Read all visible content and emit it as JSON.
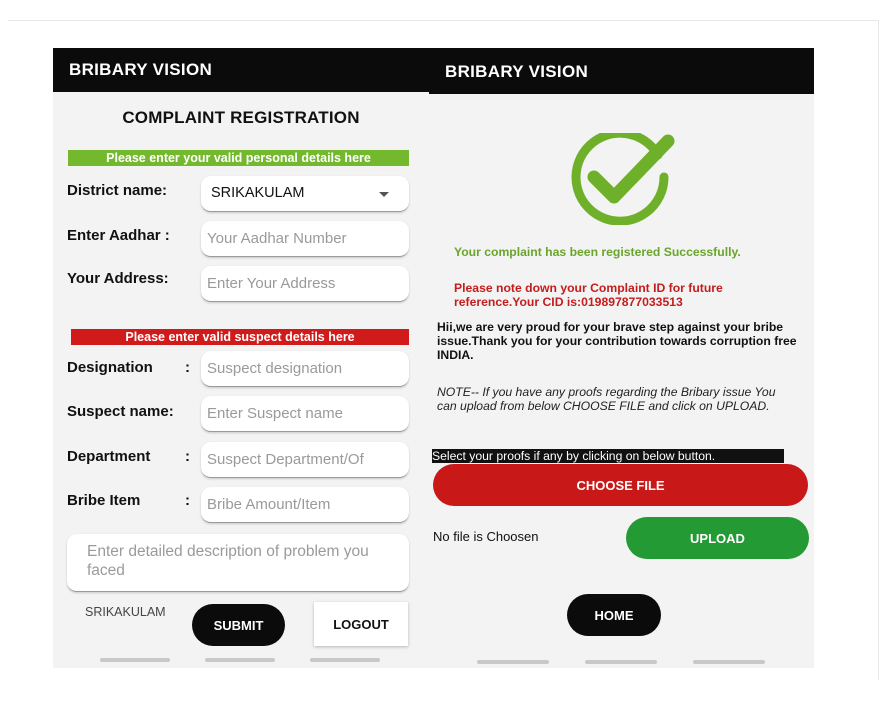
{
  "left_screen": {
    "app_title": "BRIBARY VISION",
    "page_title": "COMPLAINT REGISTRATION",
    "personal_banner": "Please enter your valid personal details here",
    "district": {
      "label": "District name:",
      "value": "SRIKAKULAM"
    },
    "aadhar": {
      "label": "Enter Aadhar :",
      "placeholder": "Your Aadhar Number"
    },
    "address": {
      "label": "Your Address:",
      "placeholder": "Enter Your Address"
    },
    "suspect_banner": "Please enter valid suspect details here",
    "designation": {
      "label": "Designation",
      "colon": ":",
      "placeholder": "Suspect designation"
    },
    "suspect_name": {
      "label": "Suspect name:",
      "placeholder": "Enter Suspect name"
    },
    "department": {
      "label": "Department",
      "colon": ":",
      "placeholder": "Suspect Department/Of"
    },
    "bribe_item": {
      "label": "Bribe Item",
      "colon": ":",
      "placeholder": "Bribe Amount/Item"
    },
    "description": {
      "placeholder": "Enter detailed description of problem you faced"
    },
    "district_footer": "SRIKAKULAM",
    "submit_label": "SUBMIT",
    "logout_label": "LOGOUT"
  },
  "right_screen": {
    "app_title": "BRIBARY VISION",
    "success_message": "Your complaint has been registered Successfully.",
    "cid_note": "Please note down your Complaint ID for future reference.Your CID is:019897877033513",
    "thanks_text": "Hii,we are very proud for your brave step against your bribe issue.Thank you for your contribution towards corruption free INDIA.",
    "proof_note": "NOTE-- If you have any proofs regarding the Bribary issue You can upload from below CHOOSE FILE and click on UPLOAD.",
    "select_proofs": "Select your proofs if any by clicking on below button.",
    "choose_file_label": "CHOOSE FILE",
    "no_file_text": "No file is Choosen",
    "upload_label": "UPLOAD",
    "home_label": "HOME"
  },
  "colors": {
    "appbar": "#0b0b0b",
    "green_banner": "#74b82d",
    "red_banner": "#d11b1b",
    "success_green": "#6aa52b",
    "choose_red": "#c81818",
    "upload_green": "#239a34"
  },
  "icons": {
    "success": "check-circle-icon",
    "dropdown": "chevron-down-icon"
  }
}
